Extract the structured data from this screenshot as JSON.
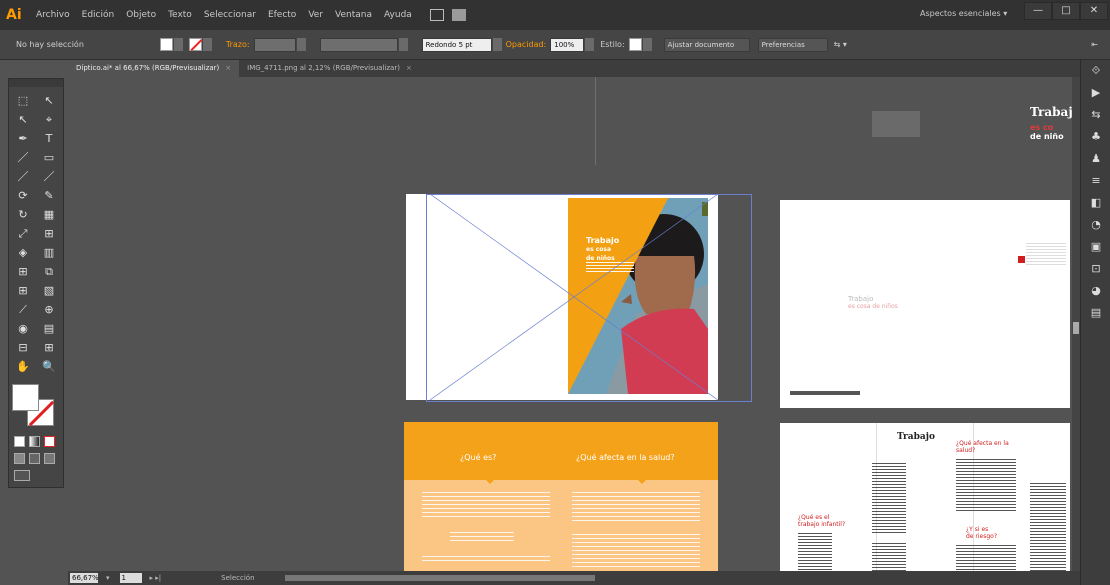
{
  "app": {
    "logo": "Ai"
  },
  "menubar": {
    "items": [
      "Archivo",
      "Edición",
      "Objeto",
      "Texto",
      "Seleccionar",
      "Efecto",
      "Ver",
      "Ventana",
      "Ayuda"
    ],
    "workspace": "Aspectos esenciales",
    "window_buttons": [
      "—",
      "□",
      "✕"
    ]
  },
  "controlbar": {
    "selection_label": "No hay selección",
    "stroke_label": "Trazo:",
    "brush_field": "Redondo 5 pt",
    "opacity_label": "Opacidad:",
    "opacity_value": "100%",
    "style_label": "Estilo:",
    "doc_setup_button": "Ajustar documento",
    "preferences_button": "Preferencias"
  },
  "tabs": [
    {
      "label": "Díptico.ai* al 66,67% (RGB/Previsualizar)",
      "active": true
    },
    {
      "label": "IMG_4711.png al 2,12% (RGB/Previsualizar)",
      "active": false
    }
  ],
  "toolbox": {
    "tools": [
      "⬚",
      "↖",
      "↖",
      "⌖",
      "✒",
      "T",
      "／",
      "▭",
      "／",
      "／",
      "⟳",
      "✎",
      "↻",
      "▦",
      "⤢",
      "⊞",
      "◈",
      "▥",
      "⊞",
      "⧉",
      "⊞",
      "▧",
      "⟋",
      "⊕",
      "◉",
      "▤",
      "⊟",
      "⊞",
      "✋",
      "🔍"
    ]
  },
  "canvas": {
    "header_title": "Trabaj",
    "header_sub_red": "es co",
    "header_sub_white": "de niño",
    "artboard1": {
      "cover_title": "Trabajo",
      "cover_line2": "es cosa",
      "cover_line3": "de niños"
    },
    "artboard2": {
      "mini_title": "Trabajo",
      "mini_red": "es cosa de niños"
    },
    "artboard3": {
      "heading_left": "¿Qué es?",
      "heading_right": "¿Qué afecta en la salud?"
    },
    "artboard4": {
      "title": "Trabajo",
      "red1": "¿Qué es el",
      "red2": "trabajo infantil?",
      "red3": "¿Qué afecta en la",
      "red4": "salud?",
      "red5": "¿Y si es",
      "red6": "de riesgo?"
    }
  },
  "dock": {
    "icons": [
      "⟐",
      "▶",
      "⇆",
      "♣",
      "♟",
      "≡",
      "◧",
      "◔",
      "▣",
      "⊡",
      "◕",
      "▤"
    ]
  },
  "statusbar": {
    "zoom": "66,67%",
    "page": "1",
    "tool": "Selección"
  }
}
